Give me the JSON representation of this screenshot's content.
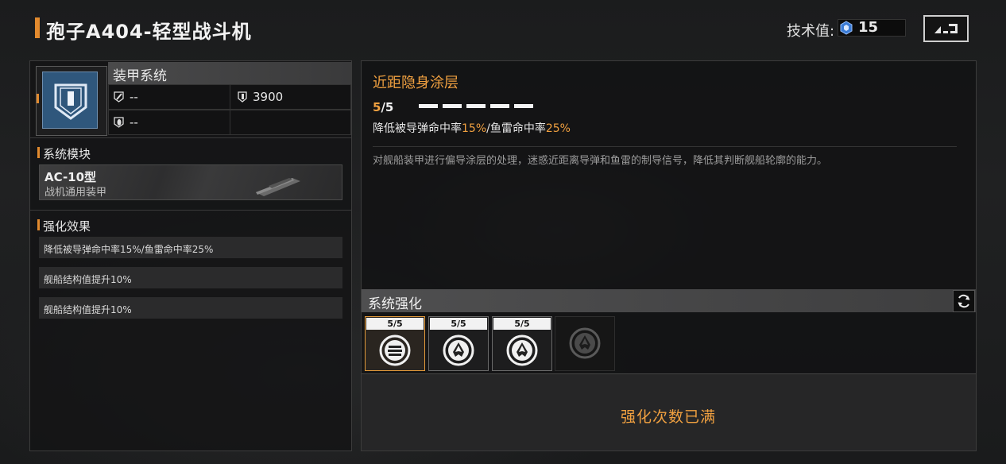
{
  "header": {
    "title": "孢子A404-轻型战斗机",
    "tech_label": "技术值:",
    "tech_value": "15"
  },
  "equipment": {
    "system_name": "装甲系统",
    "stats": [
      {
        "icon": "shield-missile-icon",
        "value": "--"
      },
      {
        "icon": "armor-shield-icon",
        "value": "3900"
      },
      {
        "icon": "shield-torpedo-icon",
        "value": "--"
      }
    ]
  },
  "module": {
    "section_label": "系统模块",
    "name": "AC-10型",
    "type": "战机通用装甲"
  },
  "effects": {
    "section_label": "强化效果",
    "items": [
      "降低被导弹命中率15%/鱼雷命中率25%",
      "舰船结构值提升10%",
      "舰船结构值提升10%"
    ]
  },
  "skill": {
    "title": "近距隐身涂层",
    "level_current": "5",
    "level_sep": "/",
    "level_max": "5",
    "level_segments_filled": 5,
    "effect_prefix": "降低被导弹命中率",
    "effect_val1": "15%",
    "effect_mid": "/鱼雷命中率",
    "effect_val2": "25%",
    "description": "对舰船装甲进行偏导涂层的处理，迷惑近距离导弹和鱼雷的制导信号，降低其判断舰船轮廓的能力。"
  },
  "upgrade": {
    "title": "系统强化",
    "nodes": [
      {
        "level": "5/5",
        "icon": "stripes-emblem-icon",
        "state": "selected"
      },
      {
        "level": "5/5",
        "icon": "ship-emblem-icon",
        "state": "done"
      },
      {
        "level": "5/5",
        "icon": "ship-emblem-icon",
        "state": "done"
      },
      {
        "level": "",
        "icon": "ship-emblem-icon",
        "state": "locked"
      }
    ],
    "max_text": "强化次数已满"
  },
  "colors": {
    "accent": "#f0a040",
    "marker": "#e28a2e",
    "icon_blue": "#2f577c"
  }
}
